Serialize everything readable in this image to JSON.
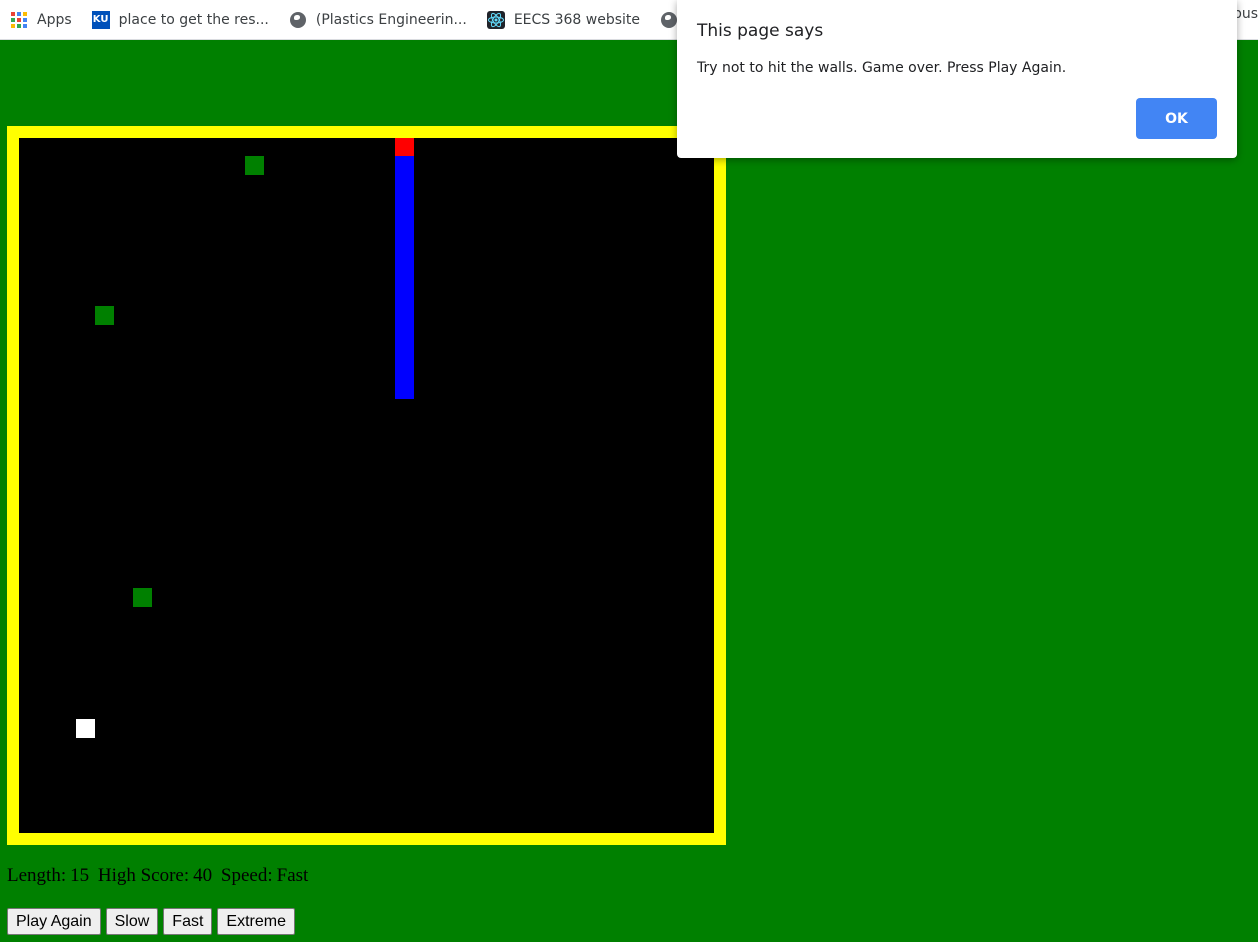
{
  "bookmarks": {
    "items": [
      {
        "label": "Apps",
        "icon": "apps-grid-icon"
      },
      {
        "label": "place to get the res...",
        "icon": "ku-logo-icon"
      },
      {
        "label": "(Plastics Engineerin...",
        "icon": "globe-icon"
      },
      {
        "label": "EECS 368 website",
        "icon": "react-atom-icon"
      },
      {
        "label": "",
        "icon": "globe-icon"
      }
    ],
    "overflow_text": "bus"
  },
  "dialog": {
    "title": "This page says",
    "message": "Try not to hit the walls. Game over. Press Play Again.",
    "ok_label": "OK"
  },
  "game": {
    "colors": {
      "page_bg": "#008000",
      "border": "#ffff00",
      "board_bg": "#000000",
      "snake_head": "#ff0000",
      "snake_body": "#0000ff",
      "food": "#008000",
      "special": "#ffffff"
    },
    "snake": {
      "head_color": "#ff0000",
      "body_color": "#0000ff",
      "direction": "up"
    }
  },
  "status": {
    "length_label": "Length:",
    "length_value": "15",
    "high_score_label": "High Score:",
    "high_score_value": "40",
    "speed_label": "Speed:",
    "speed_value": "Fast"
  },
  "controls": {
    "play_again": "Play Again",
    "slow": "Slow",
    "fast": "Fast",
    "extreme": "Extreme"
  }
}
